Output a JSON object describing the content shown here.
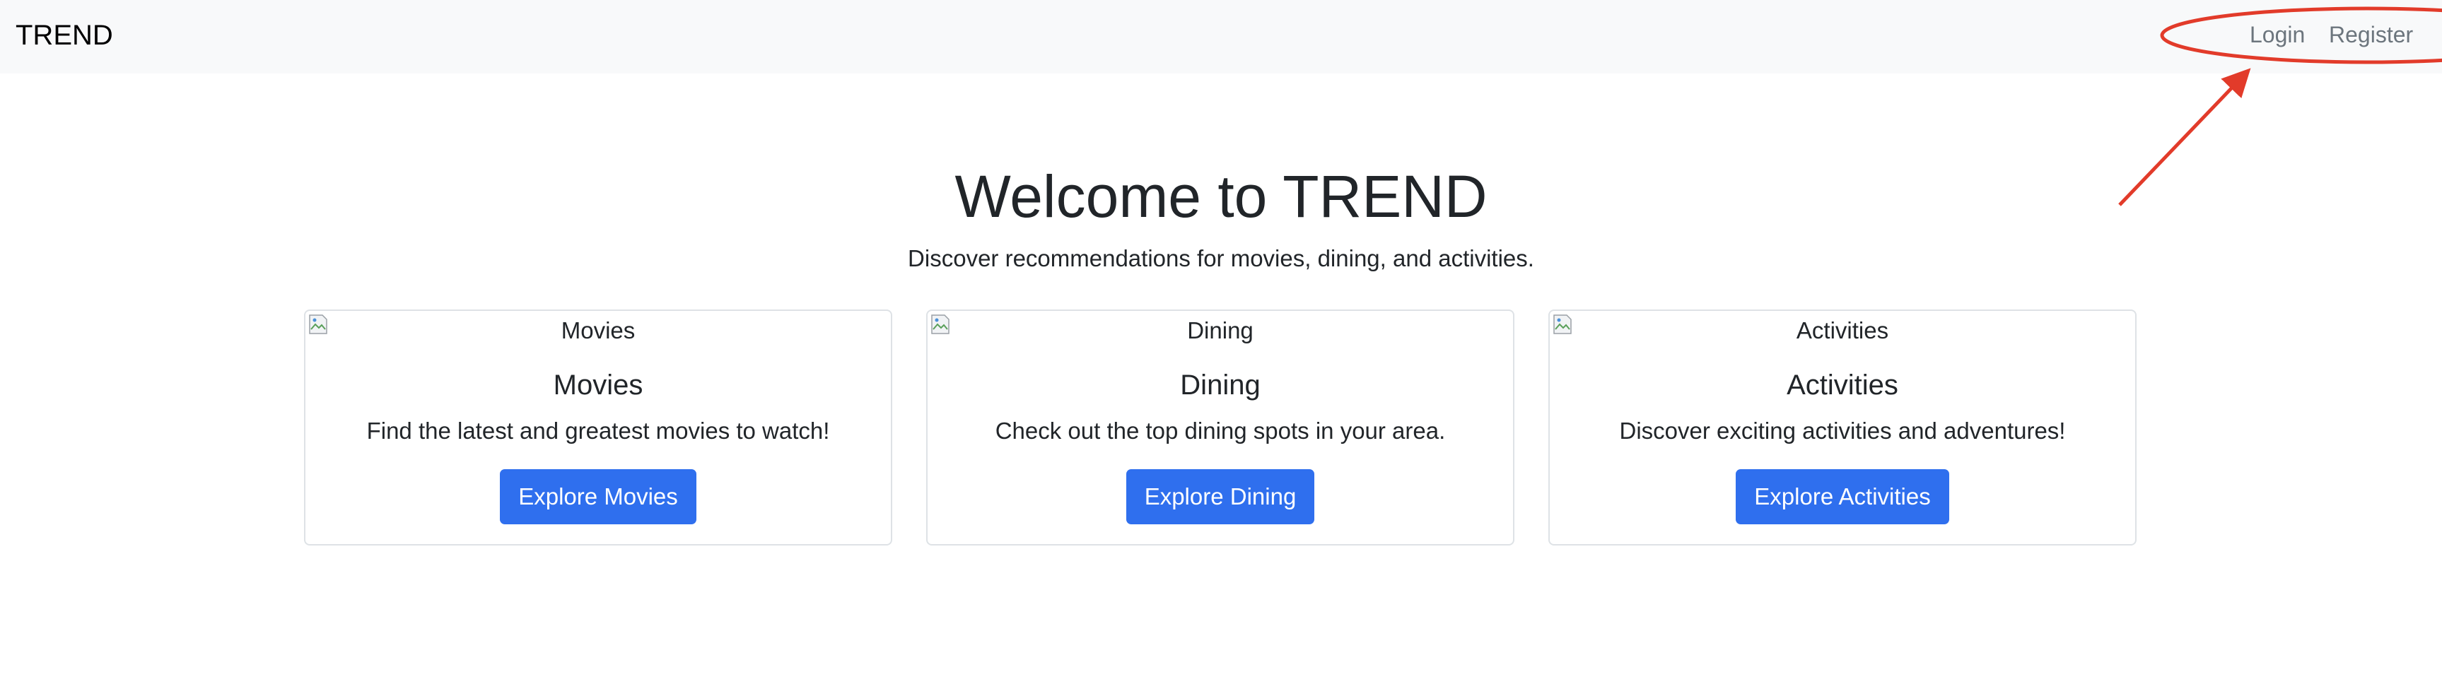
{
  "navbar": {
    "brand": "TREND",
    "links": [
      {
        "label": "Login"
      },
      {
        "label": "Register"
      }
    ]
  },
  "hero": {
    "title": "Welcome to TREND",
    "subtitle": "Discover recommendations for movies, dining, and activities."
  },
  "cards": [
    {
      "image_alt": "Movies",
      "title": "Movies",
      "text": "Find the latest and greatest movies to watch!",
      "button": "Explore Movies"
    },
    {
      "image_alt": "Dining",
      "title": "Dining",
      "text": "Check out the top dining spots in your area.",
      "button": "Explore Dining"
    },
    {
      "image_alt": "Activities",
      "title": "Activities",
      "text": "Discover exciting activities and adventures!",
      "button": "Explore Activities"
    }
  ],
  "colors": {
    "navbar_bg": "#f8f9fa",
    "nav_link": "#6c757d",
    "primary_button": "#2f6fee",
    "annotation": "#e23b2a",
    "card_border": "#dee2e6"
  },
  "icons": {
    "card_image": "broken-image-icon"
  }
}
